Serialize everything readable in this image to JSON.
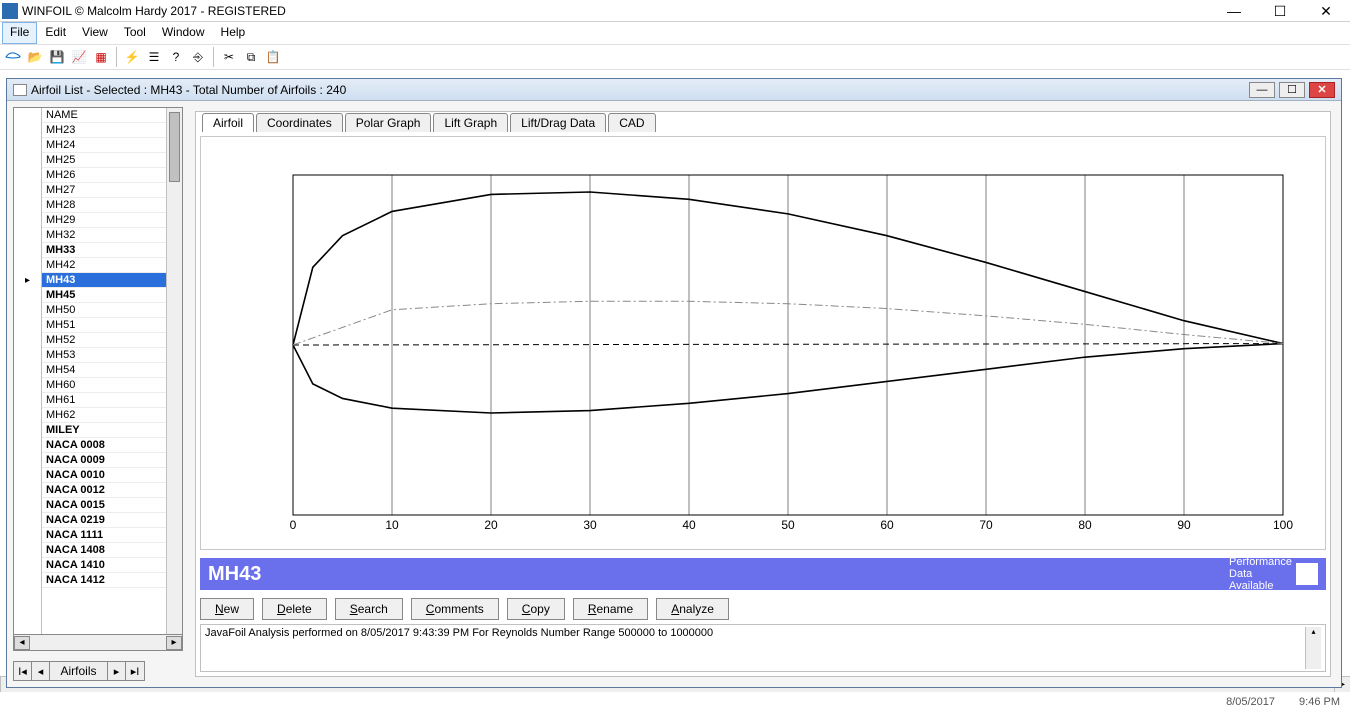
{
  "title": "WINFOIL © Malcolm Hardy 2017 - REGISTERED",
  "menus": [
    "File",
    "Edit",
    "View",
    "Tool",
    "Window",
    "Help"
  ],
  "active_menu": "File",
  "subwindow_title": "Airfoil List - Selected : MH43 - Total Number of Airfoils : 240",
  "sidebar": {
    "header": "NAME",
    "items": [
      {
        "label": "MH23",
        "bold": false
      },
      {
        "label": "MH24",
        "bold": false
      },
      {
        "label": "MH25",
        "bold": false
      },
      {
        "label": "MH26",
        "bold": false
      },
      {
        "label": "MH27",
        "bold": false
      },
      {
        "label": "MH28",
        "bold": false
      },
      {
        "label": "MH29",
        "bold": false
      },
      {
        "label": "MH32",
        "bold": false
      },
      {
        "label": "MH33",
        "bold": true
      },
      {
        "label": "MH42",
        "bold": false
      },
      {
        "label": "MH43",
        "bold": true,
        "selected": true
      },
      {
        "label": "MH45",
        "bold": true
      },
      {
        "label": "MH50",
        "bold": false
      },
      {
        "label": "MH51",
        "bold": false
      },
      {
        "label": "MH52",
        "bold": false
      },
      {
        "label": "MH53",
        "bold": false
      },
      {
        "label": "MH54",
        "bold": false
      },
      {
        "label": "MH60",
        "bold": false
      },
      {
        "label": "MH61",
        "bold": false
      },
      {
        "label": "MH62",
        "bold": false
      },
      {
        "label": "MILEY",
        "bold": true
      },
      {
        "label": "NACA 0008",
        "bold": true
      },
      {
        "label": "NACA 0009",
        "bold": true
      },
      {
        "label": "NACA 0010",
        "bold": true
      },
      {
        "label": "NACA 0012",
        "bold": true
      },
      {
        "label": "NACA 0015",
        "bold": true
      },
      {
        "label": "NACA 0219",
        "bold": true
      },
      {
        "label": "NACA 1111",
        "bold": true
      },
      {
        "label": "NACA 1408",
        "bold": true
      },
      {
        "label": "NACA 1410",
        "bold": true
      },
      {
        "label": "NACA 1412",
        "bold": true
      }
    ],
    "nav_label": "Airfoils"
  },
  "tabs": [
    {
      "label": "Airfoil",
      "active": true
    },
    {
      "label": "Coordinates"
    },
    {
      "label": "Polar Graph"
    },
    {
      "label": "Lift Graph"
    },
    {
      "label": "Lift/Drag Data"
    },
    {
      "label": "CAD"
    }
  ],
  "chart_data": {
    "type": "line",
    "title": "",
    "xlabel": "",
    "ylabel": "",
    "xlim": [
      0,
      100
    ],
    "xticks": [
      0,
      10,
      20,
      30,
      40,
      50,
      60,
      70,
      80,
      90,
      100
    ],
    "series": [
      {
        "name": "upper",
        "color": "#000",
        "stroke": "solid",
        "x": [
          0,
          2,
          5,
          10,
          20,
          30,
          40,
          50,
          60,
          70,
          80,
          90,
          100
        ],
        "y": [
          0,
          3.2,
          4.5,
          5.5,
          6.2,
          6.3,
          6.0,
          5.4,
          4.5,
          3.4,
          2.2,
          1.0,
          0.06
        ]
      },
      {
        "name": "lower",
        "color": "#000",
        "stroke": "solid",
        "x": [
          0,
          2,
          5,
          10,
          20,
          30,
          40,
          50,
          60,
          70,
          80,
          90,
          100
        ],
        "y": [
          0,
          -1.6,
          -2.2,
          -2.6,
          -2.8,
          -2.7,
          -2.4,
          -2.0,
          -1.5,
          -1.0,
          -0.5,
          -0.15,
          0.06
        ]
      },
      {
        "name": "chord",
        "color": "#000",
        "stroke": "dash",
        "x": [
          0,
          100
        ],
        "y": [
          0,
          0.06
        ]
      },
      {
        "name": "camber",
        "color": "#888",
        "stroke": "dashdot",
        "x": [
          0,
          10,
          20,
          30,
          40,
          50,
          60,
          70,
          80,
          90,
          100
        ],
        "y": [
          0,
          1.45,
          1.7,
          1.8,
          1.8,
          1.7,
          1.5,
          1.2,
          0.85,
          0.43,
          0.06
        ]
      }
    ]
  },
  "banner": {
    "name": "MH43",
    "msg": "Performance\nData\nAvailable"
  },
  "actions": [
    "New",
    "Delete",
    "Search",
    "Comments",
    "Copy",
    "Rename",
    "Analyze"
  ],
  "status_text": "JavaFoil Analysis performed on 8/05/2017 9:43:39 PM  For Reynolds Number Range 500000 to 1000000",
  "statusbar": {
    "date": "8/05/2017",
    "time": "9:46 PM"
  }
}
